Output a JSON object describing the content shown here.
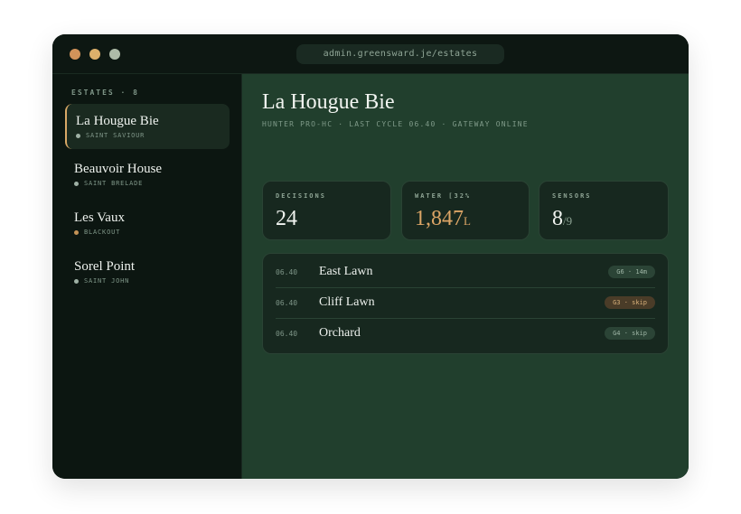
{
  "browser": {
    "url": "admin.greensward.je/estates"
  },
  "sidebar": {
    "header": "ESTATES · 8",
    "items": [
      {
        "name": "La Hougue Bie",
        "sub": "SAINT SAVIOUR",
        "dot_color": "#9fb1a5"
      },
      {
        "name": "Beauvoir House",
        "sub": "SAINT BRELADE",
        "dot_color": "#9fb1a5"
      },
      {
        "name": "Les Vaux",
        "sub": "BLACKOUT",
        "dot_color": "#c49256"
      },
      {
        "name": "Sorel Point",
        "sub": "SAINT JOHN",
        "dot_color": "#9fb1a5"
      }
    ]
  },
  "main": {
    "title": "La Hougue Bie",
    "subtitle": "HUNTER PRO-HC · LAST CYCLE 06.40 · GATEWAY ONLINE",
    "cards": [
      {
        "label": "DECISIONS",
        "value": "24",
        "unit": ""
      },
      {
        "label": "WATER [32%",
        "value": "1,847",
        "unit": "L"
      },
      {
        "label": "SENSORS",
        "value": "8",
        "unit": "/9"
      }
    ],
    "rows": [
      {
        "time": "06.40",
        "zone": "East Lawn",
        "badge": "G6 · 14m",
        "status": "ok"
      },
      {
        "time": "06.40",
        "zone": "Cliff Lawn",
        "badge": "G3 · skip",
        "status": "warn"
      },
      {
        "time": "06.40",
        "zone": "Orchard",
        "badge": "G4 · skip",
        "status": "ok"
      }
    ]
  },
  "colors": {
    "accent": "#d8a866",
    "panel": "#213f2d",
    "sidebar": "#0c1611"
  }
}
